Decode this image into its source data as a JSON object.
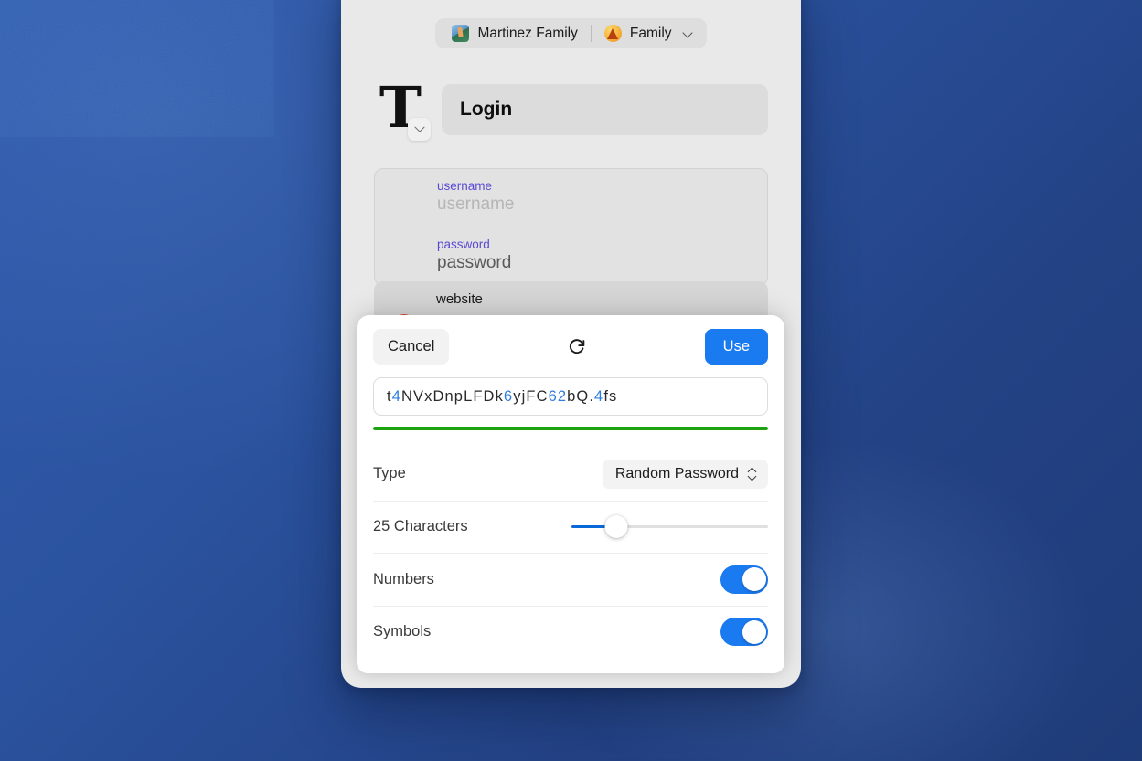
{
  "window": {
    "account_bar": {
      "profile": {
        "icon": "person-hiking-emoji",
        "label": "Martinez Family"
      },
      "vault": {
        "icon": "tent-emoji",
        "label": "Family"
      },
      "chevron": "chevron-down-icon"
    },
    "item": {
      "logo": "T",
      "logo_badge_icon": "chevron-down-icon",
      "title": "Login",
      "fields": [
        {
          "label": "username",
          "value": "username",
          "is_placeholder": true
        },
        {
          "label": "password",
          "value": "password",
          "is_placeholder": false
        }
      ],
      "website_section": {
        "label": "website",
        "favicon": "site-favicon",
        "share_icon": "share-icon",
        "more_icon": "more-icon"
      }
    }
  },
  "generator_sheet": {
    "cancel_label": "Cancel",
    "refresh_icon": "refresh-icon",
    "use_label": "Use",
    "password": "t4NVxDnpLFDk6yjFC62bQ.4fs",
    "strength": {
      "percent": 100,
      "color": "#1ca30f"
    },
    "options": {
      "type_label": "Type",
      "type_value": "Random Password",
      "type_stepper_icon": "stepper-updown-icon",
      "length_label": "25 Characters",
      "length_percent": 23,
      "numbers_label": "Numbers",
      "numbers_on": true,
      "symbols_label": "Symbols",
      "symbols_on": true
    }
  },
  "colors": {
    "accent_blue": "#1a7af0",
    "slider_blue": "#0a69d8",
    "strength_green": "#1ca30f",
    "label_purple": "#5b4ad1",
    "desktop_blue": "#2f5aad"
  }
}
